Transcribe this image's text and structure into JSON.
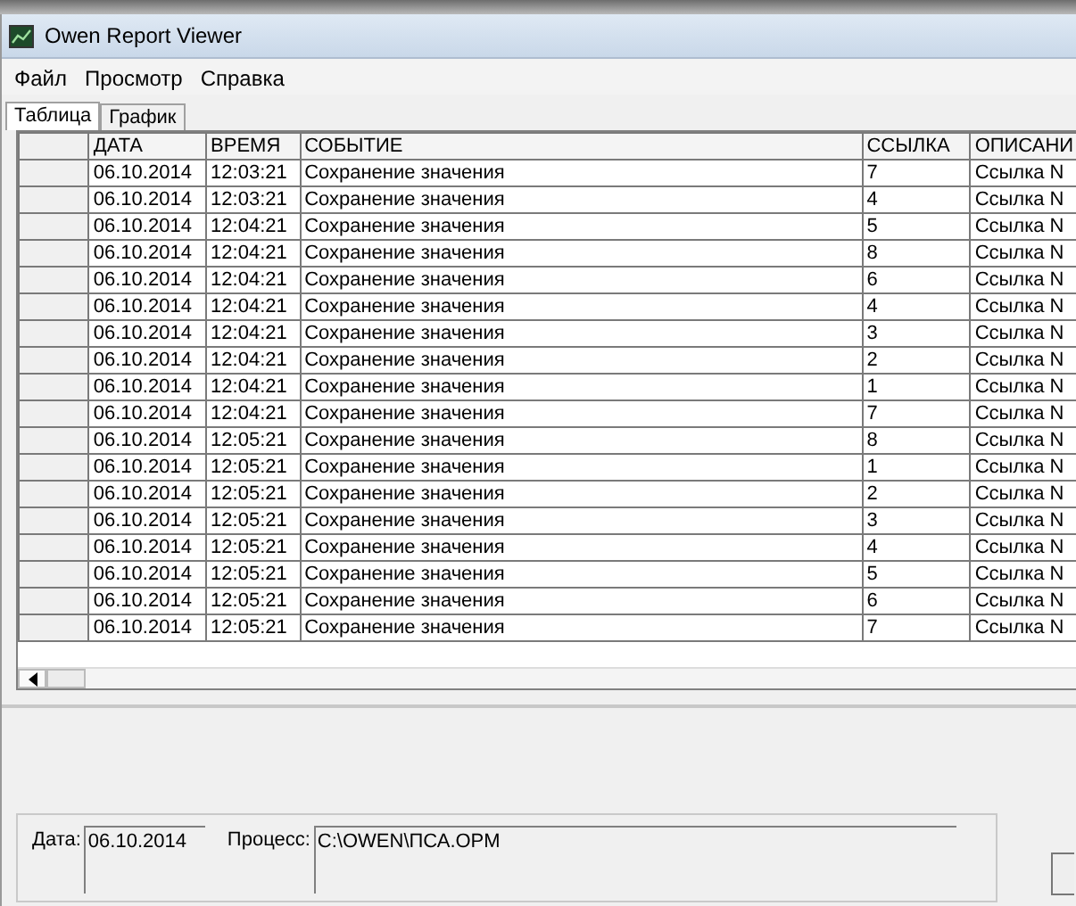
{
  "window": {
    "title": "Owen Report Viewer"
  },
  "menu": [
    "Файл",
    "Просмотр",
    "Справка"
  ],
  "tabs": [
    {
      "label": "Таблица",
      "selected": true
    },
    {
      "label": "График",
      "selected": false
    }
  ],
  "table": {
    "columns": [
      "ДАТА",
      "ВРЕМЯ",
      "СОБЫТИЕ",
      "ССЫЛКА",
      "ОПИСАНИ"
    ],
    "rows": [
      [
        "06.10.2014",
        "12:03:21",
        "Сохранение значения",
        "7",
        "Ссылка N"
      ],
      [
        "06.10.2014",
        "12:03:21",
        "Сохранение значения",
        "4",
        "Ссылка N"
      ],
      [
        "06.10.2014",
        "12:04:21",
        "Сохранение значения",
        "5",
        "Ссылка N"
      ],
      [
        "06.10.2014",
        "12:04:21",
        "Сохранение значения",
        "8",
        "Ссылка N"
      ],
      [
        "06.10.2014",
        "12:04:21",
        "Сохранение значения",
        "6",
        "Ссылка N"
      ],
      [
        "06.10.2014",
        "12:04:21",
        "Сохранение значения",
        "4",
        "Ссылка N"
      ],
      [
        "06.10.2014",
        "12:04:21",
        "Сохранение значения",
        "3",
        "Ссылка N"
      ],
      [
        "06.10.2014",
        "12:04:21",
        "Сохранение значения",
        "2",
        "Ссылка N"
      ],
      [
        "06.10.2014",
        "12:04:21",
        "Сохранение значения",
        "1",
        "Ссылка N"
      ],
      [
        "06.10.2014",
        "12:04:21",
        "Сохранение значения",
        "7",
        "Ссылка N"
      ],
      [
        "06.10.2014",
        "12:05:21",
        "Сохранение значения",
        "8",
        "Ссылка N"
      ],
      [
        "06.10.2014",
        "12:05:21",
        "Сохранение значения",
        "1",
        "Ссылка N"
      ],
      [
        "06.10.2014",
        "12:05:21",
        "Сохранение значения",
        "2",
        "Ссылка N"
      ],
      [
        "06.10.2014",
        "12:05:21",
        "Сохранение значения",
        "3",
        "Ссылка N"
      ],
      [
        "06.10.2014",
        "12:05:21",
        "Сохранение значения",
        "4",
        "Ссылка N"
      ],
      [
        "06.10.2014",
        "12:05:21",
        "Сохранение значения",
        "5",
        "Ссылка N"
      ],
      [
        "06.10.2014",
        "12:05:21",
        "Сохранение значения",
        "6",
        "Ссылка N"
      ],
      [
        "06.10.2014",
        "12:05:21",
        "Сохранение значения",
        "7",
        "Ссылка N"
      ]
    ]
  },
  "details": [
    {
      "label": "Дата:",
      "value": "06.10.2014",
      "kind": "short"
    },
    {
      "label": "Процесс:",
      "value": "C:\\OWEN\\ПСА.OPM",
      "kind": "long"
    }
  ]
}
